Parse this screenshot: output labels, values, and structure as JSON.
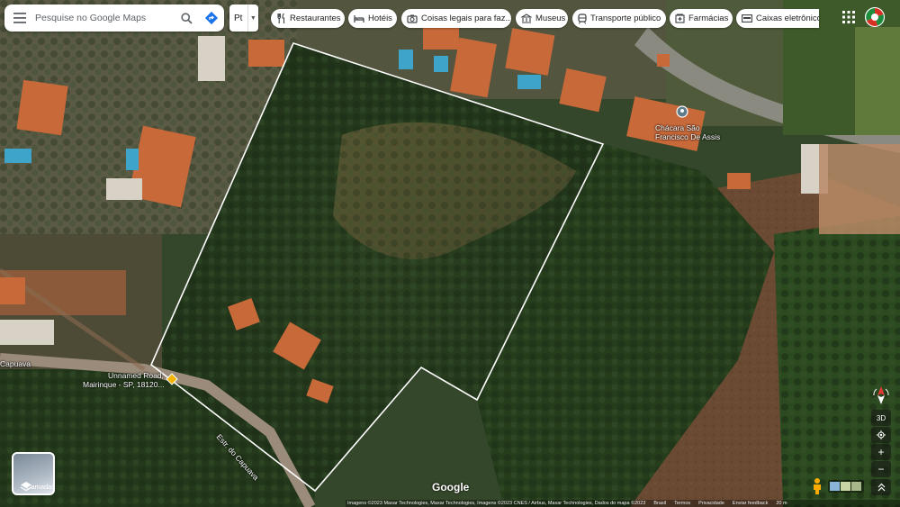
{
  "search": {
    "placeholder": "Pesquise no Google Maps"
  },
  "language": {
    "label": "Pt"
  },
  "chips": [
    {
      "label": "Restaurantes",
      "icon": "fork-knife-icon"
    },
    {
      "label": "Hotéis",
      "icon": "bed-icon"
    },
    {
      "label": "Coisas legais para faz...",
      "icon": "camera-icon"
    },
    {
      "label": "Museus",
      "icon": "museum-icon"
    },
    {
      "label": "Transporte público",
      "icon": "train-icon"
    },
    {
      "label": "Farmácias",
      "icon": "pharmacy-icon"
    },
    {
      "label": "Caixas eletrônico",
      "icon": "atm-icon"
    }
  ],
  "map": {
    "place_label_1": "Chácara São",
    "place_label_2": "Francisco De Assis",
    "unnamed_road_1": "Unnamed Road,",
    "unnamed_road_2": "Mairinque - SP, 18120...",
    "road_left": "Capuava",
    "road_estr": "Estr. do Capuava"
  },
  "layers": {
    "label": "Camadas"
  },
  "controls": {
    "tilt_3d": "3D",
    "zoom_in": "+",
    "zoom_out": "−"
  },
  "brand": {
    "logo_text": "Google"
  },
  "footer": {
    "attribution": "Imagens ©2023 Maxar Technologies, Maxar Technologies, Imagens ©2023 CNES / Airbus, Maxar Technologies, Dados do mapa ©2023",
    "brasil": "Brasil",
    "termos": "Termos",
    "privacidade": "Privacidade",
    "feedback": "Enviar feedback",
    "scale": "20 m"
  },
  "colors": {
    "accent_blue": "#1a73e8",
    "boundary": "#ffffff",
    "vegetation": "#2f4a24"
  }
}
